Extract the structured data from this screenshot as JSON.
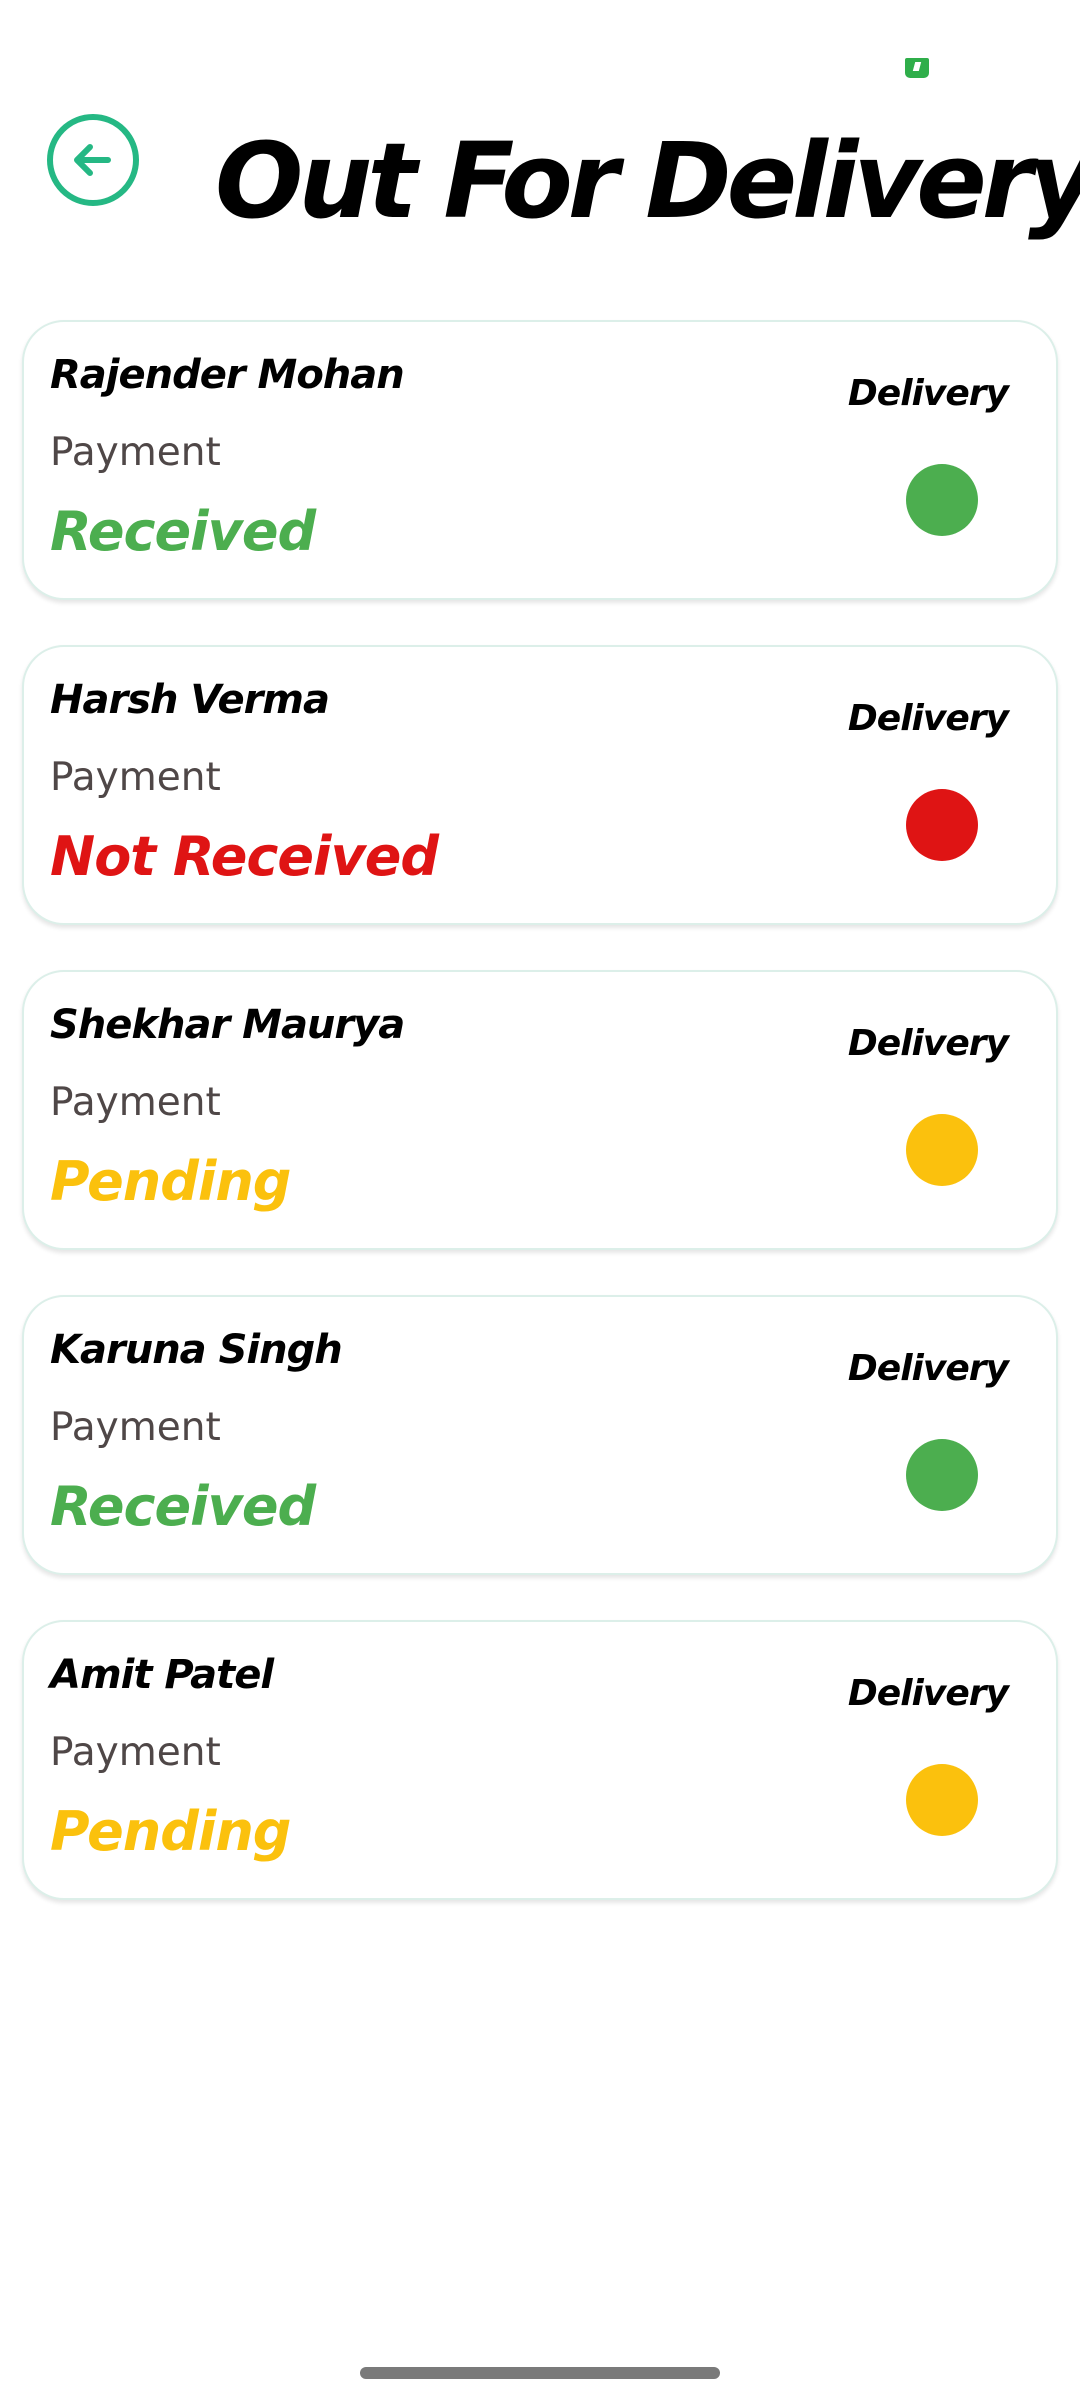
{
  "header": {
    "title": "Out For Delivery",
    "back_icon": "arrow-left-circle-icon",
    "accent_color": "#25b884"
  },
  "status_bar": {
    "icon": "green-signal-icon",
    "color": "#2fae4a"
  },
  "orders": [
    {
      "customer_name": "Rajender Mohan",
      "payment_label": "Payment",
      "payment_status": "Received",
      "status_color": "#4cae4f",
      "delivery_label": "Delivery",
      "delivery_indicator": "green"
    },
    {
      "customer_name": "Harsh Verma",
      "payment_label": "Payment",
      "payment_status": "Not Received",
      "status_color": "#df1414",
      "delivery_label": "Delivery",
      "delivery_indicator": "red"
    },
    {
      "customer_name": "Shekhar Maurya",
      "payment_label": "Payment",
      "payment_status": "Pending",
      "status_color": "#fbc10d",
      "delivery_label": "Delivery",
      "delivery_indicator": "yellow"
    },
    {
      "customer_name": "Karuna Singh",
      "payment_label": "Payment",
      "payment_status": "Received",
      "status_color": "#4cae4f",
      "delivery_label": "Delivery",
      "delivery_indicator": "green"
    },
    {
      "customer_name": "Amit Patel",
      "payment_label": "Payment",
      "payment_status": "Pending",
      "status_color": "#fbc10d",
      "delivery_label": "Delivery",
      "delivery_indicator": "yellow"
    }
  ]
}
